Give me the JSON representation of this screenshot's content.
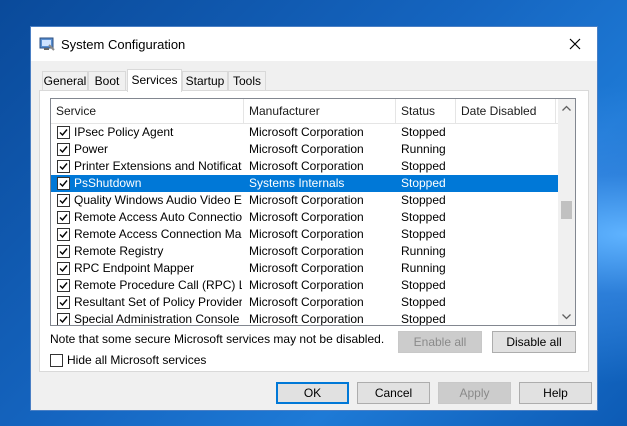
{
  "window": {
    "title": "System Configuration"
  },
  "tabs": [
    {
      "label": "General"
    },
    {
      "label": "Boot"
    },
    {
      "label": "Services"
    },
    {
      "label": "Startup"
    },
    {
      "label": "Tools"
    }
  ],
  "columns": [
    "Service",
    "Manufacturer",
    "Status",
    "Date Disabled"
  ],
  "rows": [
    {
      "checked": true,
      "service": "IPsec Policy Agent",
      "manufacturer": "Microsoft Corporation",
      "status": "Stopped",
      "date_disabled": ""
    },
    {
      "checked": true,
      "service": "Power",
      "manufacturer": "Microsoft Corporation",
      "status": "Running",
      "date_disabled": ""
    },
    {
      "checked": true,
      "service": "Printer Extensions and Notificati...",
      "manufacturer": "Microsoft Corporation",
      "status": "Stopped",
      "date_disabled": ""
    },
    {
      "checked": true,
      "service": "PsShutdown",
      "manufacturer": "Systems Internals",
      "status": "Stopped",
      "date_disabled": "",
      "selected": true
    },
    {
      "checked": true,
      "service": "Quality Windows Audio Video Ex...",
      "manufacturer": "Microsoft Corporation",
      "status": "Stopped",
      "date_disabled": ""
    },
    {
      "checked": true,
      "service": "Remote Access Auto Connection...",
      "manufacturer": "Microsoft Corporation",
      "status": "Stopped",
      "date_disabled": ""
    },
    {
      "checked": true,
      "service": "Remote Access Connection Man...",
      "manufacturer": "Microsoft Corporation",
      "status": "Stopped",
      "date_disabled": ""
    },
    {
      "checked": true,
      "service": "Remote Registry",
      "manufacturer": "Microsoft Corporation",
      "status": "Running",
      "date_disabled": ""
    },
    {
      "checked": true,
      "service": "RPC Endpoint Mapper",
      "manufacturer": "Microsoft Corporation",
      "status": "Running",
      "date_disabled": ""
    },
    {
      "checked": true,
      "service": "Remote Procedure Call (RPC) Lo...",
      "manufacturer": "Microsoft Corporation",
      "status": "Stopped",
      "date_disabled": ""
    },
    {
      "checked": true,
      "service": "Resultant Set of Policy Provider",
      "manufacturer": "Microsoft Corporation",
      "status": "Stopped",
      "date_disabled": ""
    },
    {
      "checked": true,
      "service": "Special Administration Console H...",
      "manufacturer": "Microsoft Corporation",
      "status": "Stopped",
      "date_disabled": ""
    }
  ],
  "note": "Note that some secure Microsoft services may not be disabled.",
  "buttons": {
    "enable_all": "Enable all",
    "disable_all": "Disable all",
    "ok": "OK",
    "cancel": "Cancel",
    "apply": "Apply",
    "help": "Help"
  },
  "hide_ms_services": {
    "label": "Hide all Microsoft services",
    "checked": false
  },
  "colors": {
    "selection": "#0078d7",
    "accent": "#0078d7"
  }
}
